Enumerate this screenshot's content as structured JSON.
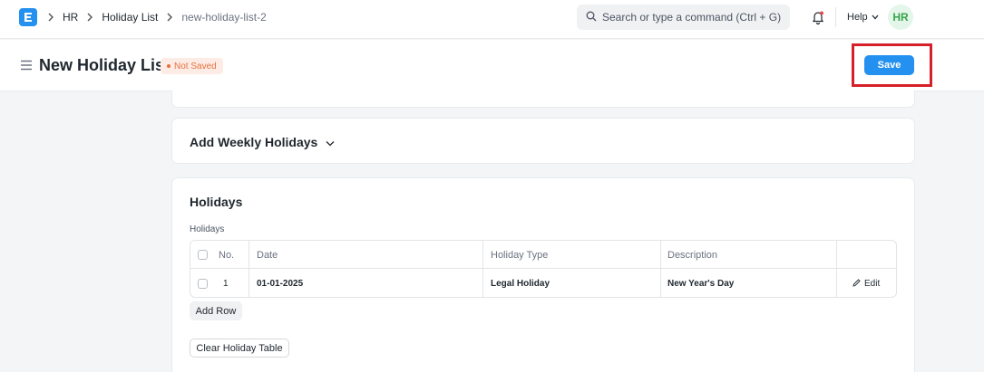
{
  "navbar": {
    "breadcrumbs": [
      "HR",
      "Holiday List",
      "new-holiday-list-2"
    ],
    "search_placeholder": "Search or type a command (Ctrl + G)",
    "help_label": "Help",
    "avatar_initials": "HR"
  },
  "header": {
    "title": "New Holiday List",
    "status": "Not Saved",
    "save_label": "Save"
  },
  "weekly_section": {
    "title": "Add Weekly Holidays"
  },
  "holidays_section": {
    "title": "Holidays",
    "table_label": "Holidays",
    "columns": [
      "No.",
      "Date",
      "Holiday Type",
      "Description"
    ],
    "rows": [
      {
        "no": "1",
        "date": "01-01-2025",
        "type": "Legal Holiday",
        "description": "New Year's Day",
        "edit_label": "Edit"
      }
    ],
    "add_row_label": "Add Row",
    "clear_label": "Clear Holiday Table"
  },
  "colors": {
    "primary": "#2490ef",
    "highlight": "#d6202a",
    "badge_text": "#e8713d",
    "avatar_text": "#36a44a"
  }
}
